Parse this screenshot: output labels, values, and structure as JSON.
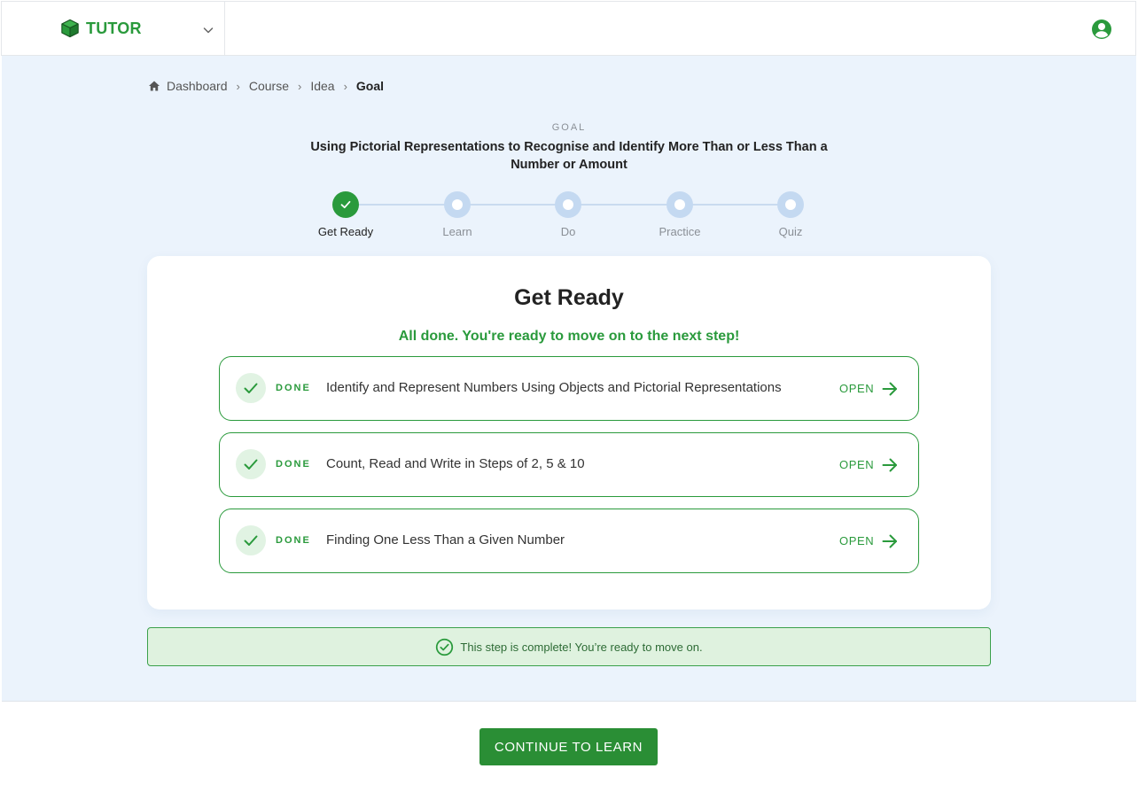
{
  "header": {
    "brand_name": "TUTOR",
    "brand_icon": "cube-icon",
    "dropdown_icon": "chevron-down-icon",
    "user_icon": "user-circle-icon"
  },
  "breadcrumb": {
    "items": [
      "Dashboard",
      "Course",
      "Idea"
    ],
    "current": "Goal",
    "separator": "›"
  },
  "goal": {
    "label": "GOAL",
    "title": "Using Pictorial Representations to Recognise and Identify More Than or Less Than a Number or Amount"
  },
  "steps": [
    {
      "label": "Get Ready",
      "status": "done"
    },
    {
      "label": "Learn",
      "status": "todo"
    },
    {
      "label": "Do",
      "status": "todo"
    },
    {
      "label": "Practice",
      "status": "todo"
    },
    {
      "label": "Quiz",
      "status": "todo"
    }
  ],
  "card": {
    "title": "Get Ready",
    "subtitle": "All done. You're ready to move on to the next step!",
    "tasks": [
      {
        "status": "DONE",
        "name": "Identify and Represent Numbers Using Objects and Pictorial Representations",
        "action": "OPEN"
      },
      {
        "status": "DONE",
        "name": "Count, Read and Write in Steps of 2, 5 & 10",
        "action": "OPEN"
      },
      {
        "status": "DONE",
        "name": "Finding One Less Than a Given Number",
        "action": "OPEN"
      }
    ]
  },
  "banner": {
    "text": "This step is complete! You’re ready to move on."
  },
  "footer": {
    "continue_label": "CONTINUE TO LEARN"
  },
  "colors": {
    "brand_green": "#2a9a3c",
    "button_green": "#2a8e35",
    "page_bg": "#ebf3fc",
    "step_inactive": "#c4d9f1",
    "banner_bg": "#dff2df"
  }
}
